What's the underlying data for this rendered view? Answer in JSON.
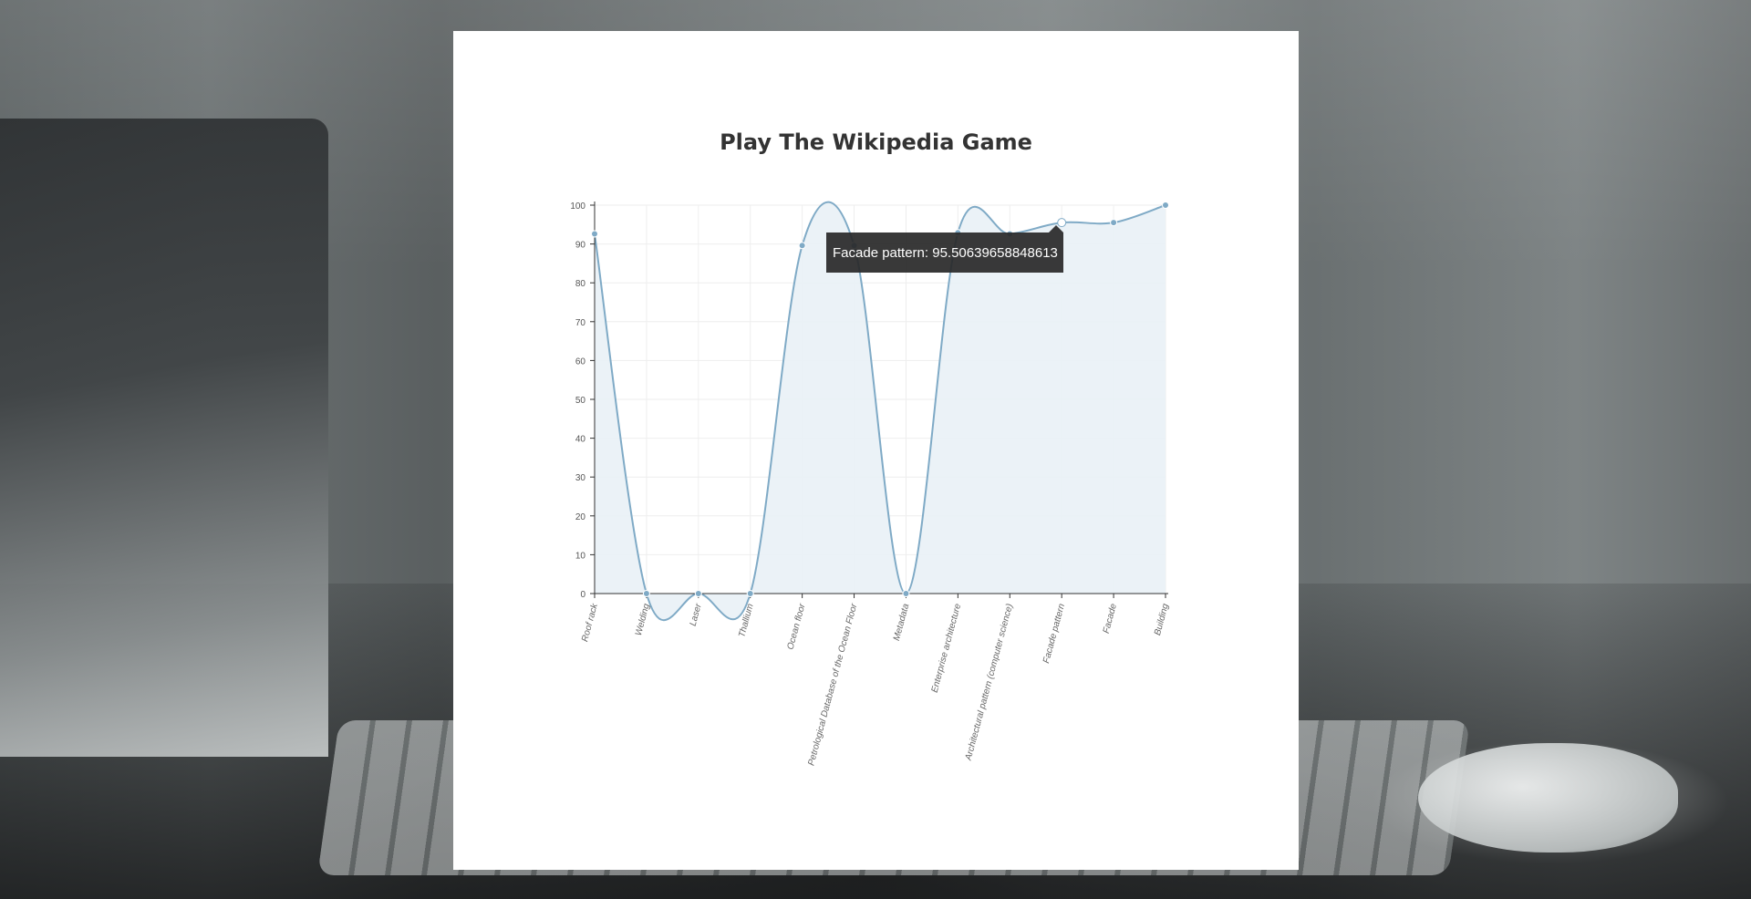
{
  "chart_data": {
    "type": "area",
    "title": "Play The Wikipedia Game",
    "categories": [
      "Roof rack",
      "Welding",
      "Laser",
      "Thallium",
      "Ocean floor",
      "Petrological Database of the Ocean Floor",
      "Metadata",
      "Enterprise architecture",
      "Architectural pattern (computer science)",
      "Facade pattern",
      "Facade",
      "Building"
    ],
    "values": [
      92.6,
      0,
      0,
      0,
      89.6,
      89.6,
      0,
      92.9,
      92.6,
      95.50639658848613,
      95.5,
      100
    ],
    "ylim": [
      0,
      100
    ],
    "yticks": [
      0,
      10,
      20,
      30,
      40,
      50,
      60,
      70,
      80,
      90,
      100
    ],
    "grid": true,
    "line_color": "#7faac6",
    "fill_color": "#e9f1f6",
    "tooltip": {
      "category": "Facade pattern",
      "value": "95.50639658848613",
      "text": "Facade pattern: 95.50639658848613"
    }
  }
}
